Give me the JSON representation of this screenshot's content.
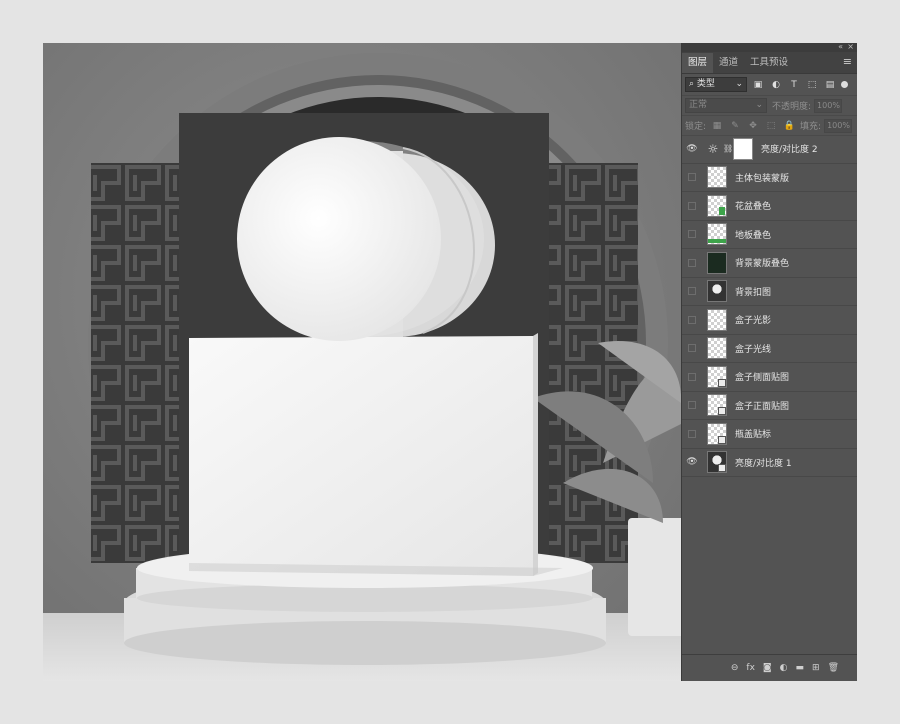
{
  "panel": {
    "top_icons": [
      "«",
      "×"
    ],
    "tabs": [
      {
        "label": "图层",
        "active": true
      },
      {
        "label": "通道",
        "active": false
      },
      {
        "label": "工具预设",
        "active": false
      }
    ],
    "filter": {
      "icon": "search-icon",
      "label": "类型"
    },
    "blend_mode": "正常",
    "opacity_label": "不透明度:",
    "opacity_value": "100%",
    "lock_label": "锁定:",
    "fill_label": "填充:",
    "fill_value": "100%"
  },
  "layers": [
    {
      "name": "亮度/对比度 2",
      "visible": true,
      "type": "adjustment"
    },
    {
      "name": "主体包装蒙版",
      "visible": false,
      "type": "pixel"
    },
    {
      "name": "花盆叠色",
      "visible": false,
      "type": "pixel-green"
    },
    {
      "name": "地板叠色",
      "visible": false,
      "type": "pixel-green"
    },
    {
      "name": "背景蒙版叠色",
      "visible": false,
      "type": "dark"
    },
    {
      "name": "背景扣图",
      "visible": false,
      "type": "photo"
    },
    {
      "name": "盒子光影",
      "visible": false,
      "type": "pixel"
    },
    {
      "name": "盒子光线",
      "visible": false,
      "type": "pixel"
    },
    {
      "name": "盒子侧面贴图",
      "visible": false,
      "type": "smart"
    },
    {
      "name": "盒子正面贴图",
      "visible": false,
      "type": "smart"
    },
    {
      "name": "瓶盖贴标",
      "visible": false,
      "type": "smart"
    },
    {
      "name": "亮度/对比度 1",
      "visible": true,
      "type": "photo"
    }
  ],
  "bottom_icons": [
    "link-icon",
    "fx-icon",
    "mask-icon",
    "adjustment-icon",
    "folder-icon",
    "new-layer-icon",
    "trash-icon"
  ],
  "bottom_glyphs": [
    "⊖",
    "fx",
    "◙",
    "◐",
    "▬",
    "⊞",
    "🗑"
  ]
}
